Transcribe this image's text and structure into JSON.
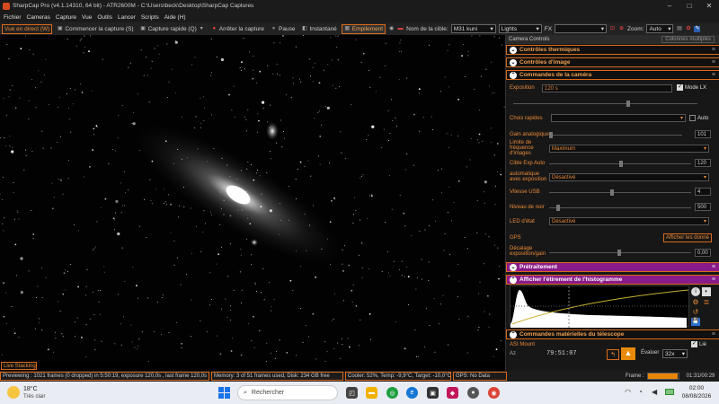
{
  "window": {
    "title": "SharpCap Pro (v4.1.14310, 64 bit) - ATR2600M - C:\\Users\\beck\\Desktop\\SharpCap Captures",
    "minimize": "–",
    "maximize": "□",
    "close": "✕"
  },
  "menu": [
    "Fichier",
    "Cameras",
    "Capture",
    "Vue",
    "Outils",
    "Lancer",
    "Scripts",
    "Aide (H)"
  ],
  "toolbar": {
    "live": "Vue en direct (W)",
    "start_capture": "Commencer la capture (S)",
    "quick_capture": "Capture rapide (Q)",
    "stop_capture": "Arrêter la capture",
    "pause": "Pause",
    "snapshot": "Instantané",
    "stacking": "Empilement",
    "target_label": "Nom de la cible:",
    "target_value": "M31 kuni",
    "frame_type": "Lights",
    "fx_label": "FX",
    "zoom_label": "Zoom:",
    "zoom_value": "Auto"
  },
  "live_stacking_tag": "Live Stacking",
  "status": {
    "preview": "Previewing : 1021 frames (0 dropped) in 5:50:19, exposure 120,0s , last frame 120,0s",
    "memory": "Memory: 3 of 51 frames used, Disk: 234 GB free",
    "cooler": "Cooler: 52%, Temp: -9,9°C, Target: -10,0°C",
    "gps": "GPS: No Data",
    "frame_label": "Frame :",
    "frame_progress": 0.98,
    "time": "01:31/00:29"
  },
  "panel": {
    "header": "Camera Controls",
    "multi_col": "Colonnes multiples",
    "sections": {
      "thermal": "Contrôles thermiques",
      "image": "Contrôles d'image",
      "camera": "Commandes de la caméra",
      "preprocessing": "Prétraitement",
      "histogram": "Afficher l'étirement de l'histogramme",
      "telescope": "Commandes matérielles du télescope"
    },
    "exposure_label": "Exposition",
    "exposure_value": "120 s",
    "lx_mode": "Mode LX",
    "quick_choice": "Choix rapides",
    "auto": "Auto",
    "gain_label": "Gain analogique",
    "gain_value": "101",
    "frame_limit_label": "Limite de fréquence d'images",
    "frame_limit_value": "Maximum",
    "auto_exp_target_label": "Cible Exp Auto",
    "auto_exp_target_value": "120",
    "auto_exposure_label": "automatique avec exposition",
    "auto_exposure_value": "Désactivé",
    "usb_speed_label": "Vitesse USB",
    "usb_speed_value": "4",
    "black_level_label": "Niveau de noir",
    "black_level_value": "500",
    "led_label": "LED d'état",
    "led_value": "Désactivé",
    "gps_label": "GPS",
    "gps_button": "Afficher les donné",
    "offset_label": "Décalage exposition/gain",
    "offset_value": "0,00",
    "mount_label": "ASI Mount",
    "link": "Lié",
    "az_label": "Az",
    "az_value": "79:51:07",
    "rate_label": "Évaluer",
    "rate_value": "32x"
  },
  "taskbar": {
    "temp": "18°C",
    "weather": "Très clair",
    "search": "Rechercher",
    "time": "02:00",
    "date": "08/08/2026"
  },
  "colors": {
    "accent": "#d96a1a",
    "purple": "#8a1a8a",
    "panel_bg": "#171717"
  }
}
